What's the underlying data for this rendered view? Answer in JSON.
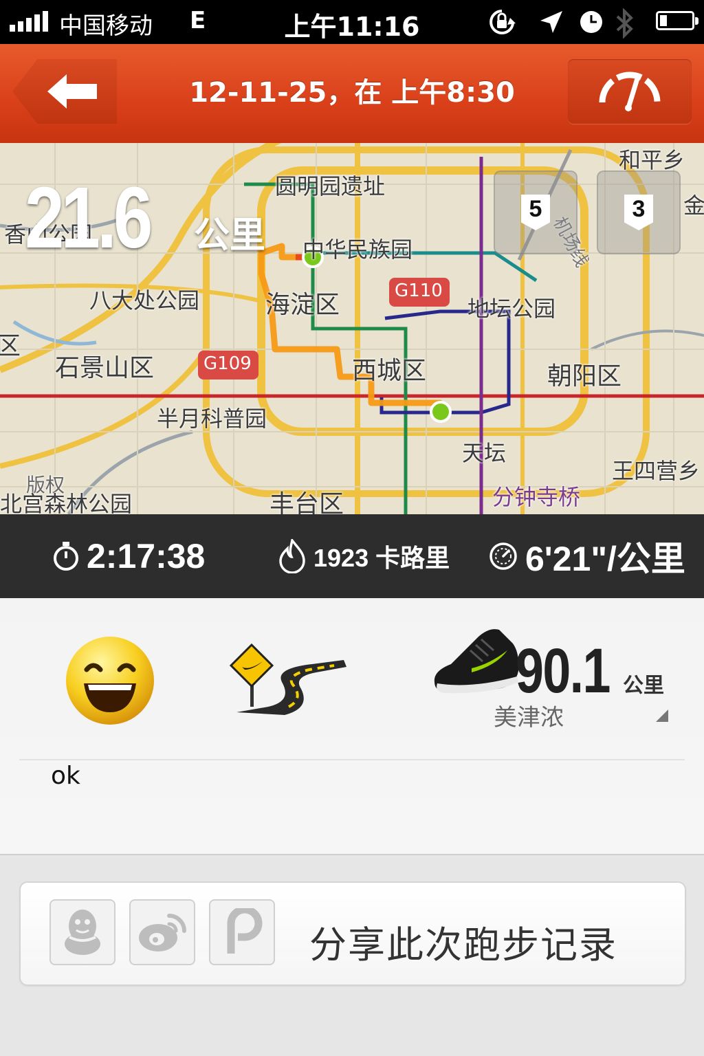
{
  "status_bar": {
    "carrier": "中国移动",
    "network": "E",
    "time": "上午11:16",
    "icons": [
      "rotation-lock-icon",
      "location-arrow-icon",
      "alarm-clock-icon",
      "bluetooth-icon",
      "battery-icon"
    ]
  },
  "nav": {
    "title": "12-11-25，在 上午8:30",
    "back_icon": "back-arrow-icon",
    "right_icon": "speedometer-icon"
  },
  "map": {
    "distance_value": "21.6",
    "distance_unit": "公里",
    "badges": [
      "5",
      "3"
    ],
    "labels": {
      "yuanmingyuan": "圆明园遗址",
      "xiangshan": "香山公园",
      "zhonghua": "中华民族园",
      "badachu": "八大处公园",
      "haidian": "海淀区",
      "g110": "G110",
      "ditan": "地坛公园",
      "qu": "区",
      "shijingshan": "石景山区",
      "g109": "G109",
      "xicheng": "西城区",
      "chaoyang": "朝阳区",
      "banyue": "半月科普园",
      "tiantan": "天坛",
      "wangsiying": "王四营乡",
      "banquan": "版权",
      "beigong": "北宫森林公园",
      "fengtai": "丰台区",
      "fenzhongsi": "分钟寺桥",
      "heping": "和平乡",
      "jichang": "机场线",
      "jin": "金"
    }
  },
  "stats": {
    "duration": "2:17:38",
    "calories": "1923 卡路里",
    "pace": "6'21\"/公里"
  },
  "details": {
    "mood_icon": "grinning-face-icon",
    "terrain_icon": "road-icon",
    "shoe_icon": "running-shoe-icon",
    "shoe_distance": "90.1",
    "shoe_distance_unit": "公里",
    "shoe_name": "美津浓",
    "note": "ok"
  },
  "share": {
    "label": "分享此次跑步记录",
    "icons": [
      "qq-icon",
      "weibo-icon",
      "path-icon"
    ]
  },
  "colors": {
    "nav_red": "#d9401a",
    "stats_bg": "#2d2d2d",
    "route_orange": "#f5a31c",
    "route_dot_green": "#7bc81c"
  }
}
